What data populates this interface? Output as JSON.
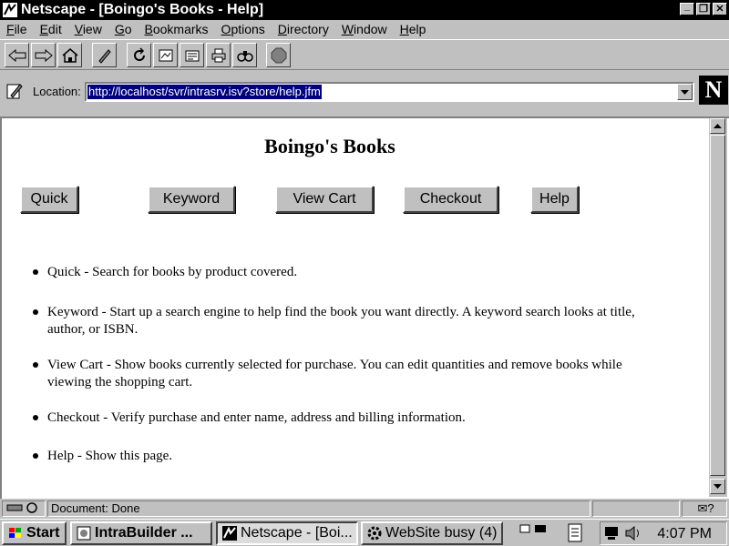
{
  "window": {
    "title": "Netscape - [Boingo's Books - Help]",
    "min_glyph": "_",
    "restore_glyph": "❐",
    "close_glyph": "✕"
  },
  "menu": [
    "File",
    "Edit",
    "View",
    "Go",
    "Bookmarks",
    "Options",
    "Directory",
    "Window",
    "Help"
  ],
  "menu_underline": [
    "F",
    "E",
    "V",
    "G",
    "B",
    "O",
    "D",
    "W",
    "H"
  ],
  "toolbar": {
    "icons": [
      "back-icon",
      "forward-icon",
      "home-icon",
      "edit-icon",
      "reload-icon",
      "images-icon",
      "open-icon",
      "print-icon",
      "find-icon",
      "stop-icon"
    ]
  },
  "location": {
    "label": "Location:",
    "url": "http://localhost/svr/intrasrv.isv?store/help.jfm"
  },
  "logo_letter": "N",
  "page": {
    "title": "Boingo's Books",
    "buttons": [
      "Quick",
      "Keyword",
      "View Cart",
      "Checkout",
      "Help"
    ],
    "items": [
      "Quick - Search for books by product covered.",
      "Keyword - Start up a search engine to help find the book you want directly. A keyword search looks at title, author, or ISBN.",
      "View Cart - Show books currently selected for purchase. You can edit quantities and remove books while viewing the shopping cart.",
      "Checkout - Verify purchase and enter name, address and billing information.",
      "Help - Show this page."
    ]
  },
  "status": {
    "text": "Document: Done",
    "mail_glyph": "✉?"
  },
  "taskbar": {
    "start": "Start",
    "tasks": [
      "IntraBuilder ...",
      "Netscape - [Boi...",
      "WebSite busy (4)"
    ],
    "clock": "4:07 PM"
  },
  "colors": {
    "title_bg": "#000000",
    "selection": "#000080",
    "face": "#c0c0c0"
  }
}
